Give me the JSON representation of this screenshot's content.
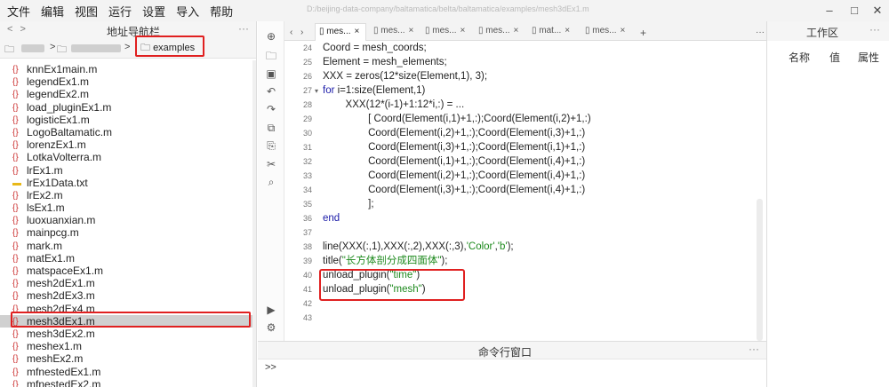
{
  "menubar": {
    "items": [
      "文件",
      "编辑",
      "视图",
      "运行",
      "设置",
      "导入",
      "帮助"
    ],
    "path": "D:/beijing-data-company/baltamatica/belta/baltamatica/examples/mesh3dEx1.m"
  },
  "window": {
    "minimize": "–",
    "maximize": "□",
    "close": "✕"
  },
  "left_panel": {
    "title": "地址导航栏",
    "back": "<",
    "forward": ">",
    "more": "···",
    "crumb_current": "examples",
    "crumb_sep": ">"
  },
  "files": [
    {
      "name": "knnEx1main.m",
      "type": "m"
    },
    {
      "name": "legendEx1.m",
      "type": "m"
    },
    {
      "name": "legendEx2.m",
      "type": "m"
    },
    {
      "name": "load_pluginEx1.m",
      "type": "m"
    },
    {
      "name": "logisticEx1.m",
      "type": "m"
    },
    {
      "name": "LogoBaltamatic.m",
      "type": "m"
    },
    {
      "name": "lorenzEx1.m",
      "type": "m"
    },
    {
      "name": "LotkaVolterra.m",
      "type": "m"
    },
    {
      "name": "lrEx1.m",
      "type": "m"
    },
    {
      "name": "lrEx1Data.txt",
      "type": "txt"
    },
    {
      "name": "lrEx2.m",
      "type": "m"
    },
    {
      "name": "lsEx1.m",
      "type": "m"
    },
    {
      "name": "luoxuanxian.m",
      "type": "m"
    },
    {
      "name": "mainpcg.m",
      "type": "m"
    },
    {
      "name": "mark.m",
      "type": "m"
    },
    {
      "name": "matEx1.m",
      "type": "m"
    },
    {
      "name": "matspaceEx1.m",
      "type": "m"
    },
    {
      "name": "mesh2dEx1.m",
      "type": "m"
    },
    {
      "name": "mesh2dEx3.m",
      "type": "m"
    },
    {
      "name": "mesh2dEx4.m",
      "type": "m"
    },
    {
      "name": "mesh3dEx1.m",
      "type": "m",
      "selected": true
    },
    {
      "name": "mesh3dEx2.m",
      "type": "m"
    },
    {
      "name": "meshex1.m",
      "type": "m"
    },
    {
      "name": "meshEx2.m",
      "type": "m"
    },
    {
      "name": "mfnestedEx1.m",
      "type": "m"
    },
    {
      "name": "mfnestedEx2.m",
      "type": "m"
    }
  ],
  "tabs": [
    {
      "label": "mes...",
      "active": true
    },
    {
      "label": "mes..."
    },
    {
      "label": "mes..."
    },
    {
      "label": "mes..."
    },
    {
      "label": "mat..."
    },
    {
      "label": "mes..."
    }
  ],
  "tab_controls": {
    "prev": "‹",
    "next": "›",
    "add": "+",
    "close": "×",
    "more": "···"
  },
  "editor": {
    "lines": [
      {
        "n": "24",
        "segs": [
          {
            "t": "Coord = mesh_coords;"
          }
        ]
      },
      {
        "n": "25",
        "segs": [
          {
            "t": "Element = mesh_elements;"
          }
        ]
      },
      {
        "n": "26",
        "segs": [
          {
            "t": "XXX = zeros(12*size(Element,1), 3);"
          }
        ]
      },
      {
        "n": "27",
        "fold": true,
        "segs": [
          {
            "t": "for",
            "c": "kw"
          },
          {
            "t": " i=1:size(Element,1)"
          }
        ]
      },
      {
        "n": "28",
        "segs": [
          {
            "t": "        XXX(12*(i-1)+1:12*i,:) = ..."
          }
        ]
      },
      {
        "n": "29",
        "segs": [
          {
            "t": "                [ Coord(Element(i,1)+1,:);Coord(Element(i,2)+1,:)"
          }
        ]
      },
      {
        "n": "30",
        "segs": [
          {
            "t": "                Coord(Element(i,2)+1,:);Coord(Element(i,3)+1,:)"
          }
        ]
      },
      {
        "n": "31",
        "segs": [
          {
            "t": "                Coord(Element(i,3)+1,:);Coord(Element(i,1)+1,:)"
          }
        ]
      },
      {
        "n": "32",
        "segs": [
          {
            "t": "                Coord(Element(i,1)+1,:);Coord(Element(i,4)+1,:)"
          }
        ]
      },
      {
        "n": "33",
        "segs": [
          {
            "t": "                Coord(Element(i,2)+1,:);Coord(Element(i,4)+1,:)"
          }
        ]
      },
      {
        "n": "34",
        "segs": [
          {
            "t": "                Coord(Element(i,3)+1,:);Coord(Element(i,4)+1,:)"
          }
        ]
      },
      {
        "n": "35",
        "segs": [
          {
            "t": "                ];"
          }
        ]
      },
      {
        "n": "36",
        "segs": [
          {
            "t": "end",
            "c": "kw"
          }
        ]
      },
      {
        "n": "37",
        "segs": [
          {
            "t": ""
          }
        ]
      },
      {
        "n": "38",
        "segs": [
          {
            "t": "line(XXX(:,1),XXX(:,2),XXX(:,3),"
          },
          {
            "t": "'Color'",
            "c": "str"
          },
          {
            "t": ","
          },
          {
            "t": "'b'",
            "c": "str"
          },
          {
            "t": ");"
          }
        ]
      },
      {
        "n": "39",
        "segs": [
          {
            "t": "title("
          },
          {
            "t": "\"长方体剖分成四面体\"",
            "c": "str"
          },
          {
            "t": ");"
          }
        ]
      },
      {
        "n": "40",
        "segs": [
          {
            "t": "unload_plugin("
          },
          {
            "t": "\"time\"",
            "c": "str"
          },
          {
            "t": ")"
          }
        ]
      },
      {
        "n": "41",
        "segs": [
          {
            "t": "unload_plugin("
          },
          {
            "t": "\"mesh\"",
            "c": "str"
          },
          {
            "t": ")"
          }
        ]
      },
      {
        "n": "42",
        "segs": [
          {
            "t": ""
          }
        ]
      },
      {
        "n": "43",
        "segs": [
          {
            "t": ""
          }
        ]
      }
    ]
  },
  "command": {
    "title": "命令行窗口",
    "prompt": ">>",
    "more": "···"
  },
  "workspace": {
    "title": "工作区",
    "columns": [
      "名称",
      "值",
      "属性"
    ],
    "more": "···"
  },
  "colors": {
    "highlight": "#e02020",
    "keyword": "#1a1aa8",
    "string": "#1e8a1e"
  }
}
